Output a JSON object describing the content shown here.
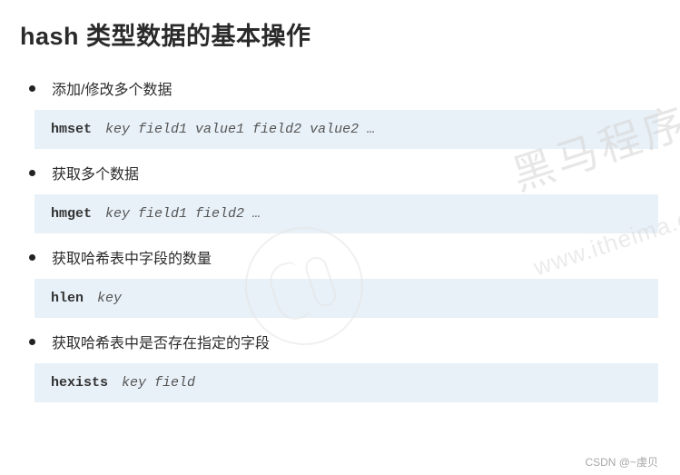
{
  "title": "hash 类型数据的基本操作",
  "ops": [
    {
      "label": "添加/修改多个数据",
      "cmd": "hmset",
      "args": "key field1 value1 field2 value2 …"
    },
    {
      "label": "获取多个数据",
      "cmd": "hmget",
      "args": "key field1 field2 …"
    },
    {
      "label": "获取哈希表中字段的数量",
      "cmd": "hlen",
      "args": "key"
    },
    {
      "label": "获取哈希表中是否存在指定的字段",
      "cmd": "hexists",
      "args": "key field"
    }
  ],
  "watermark": {
    "line1": "黑马程序员",
    "line2": "www.itheima.co"
  },
  "attribution": "CSDN @~虔贝"
}
